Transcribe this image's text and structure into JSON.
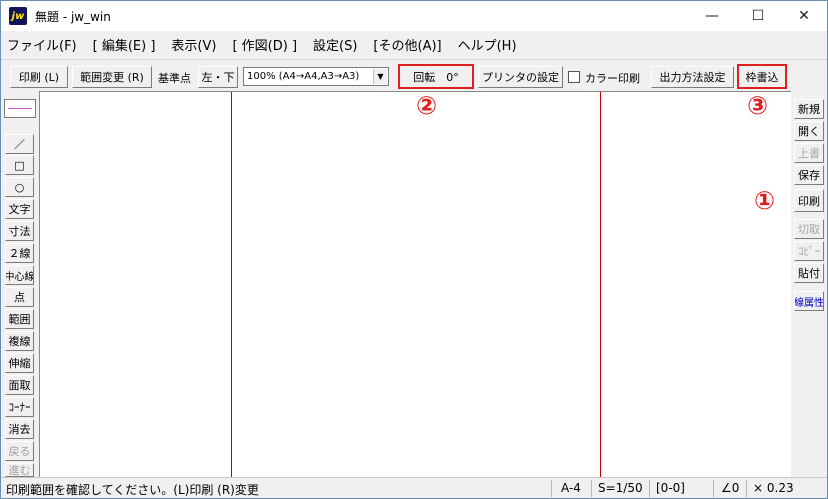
{
  "window": {
    "title": "無題 - jw_win",
    "app_icon": "jw",
    "minimize_glyph": "—",
    "maximize_glyph": "☐",
    "close_glyph": "✕"
  },
  "menu": [
    "ファイル(F)",
    "[ 編集(E) ]",
    "表示(V)",
    "[ 作図(D) ]",
    "設定(S)",
    "[その他(A)]",
    "ヘルプ(H)"
  ],
  "toolbar": {
    "print": "印刷 (L)",
    "range_change": "範囲変更 (R)",
    "base_point_label": "基準点",
    "base_point": "左・下",
    "scale": "100% (A4→A4,A3→A3)",
    "rotate": "回転　0°",
    "printer_settings": "プリンタの設定",
    "color_print": "カラー印刷",
    "output_method": "出力方法設定",
    "frame_write": "枠書込"
  },
  "annotations": {
    "n1": "①",
    "n2": "②",
    "n3": "③"
  },
  "left_tools": [
    "／",
    "□",
    "○",
    "文字",
    "寸法",
    "２線",
    "中心線",
    "点",
    "範囲",
    "複線",
    "伸縮",
    "面取",
    "ｺｰﾅｰ",
    "消去",
    "戻る",
    "進む"
  ],
  "right_tools": [
    "新規",
    "開く",
    "上書",
    "保存",
    "印刷",
    "切取",
    "ｺﾋﾟｰ",
    "貼付",
    "線属性"
  ],
  "status": {
    "message": "印刷範囲を確認してください。(L)印刷 (R)変更",
    "paper": "A-4",
    "scale": "S=1/50",
    "layer": "[0-0]",
    "angle": "∠0",
    "ratio": "× 0.23"
  },
  "colors": {
    "highlight": "#e02020",
    "print_frame": "#c00000",
    "line_attr_text": "#0000c0"
  }
}
